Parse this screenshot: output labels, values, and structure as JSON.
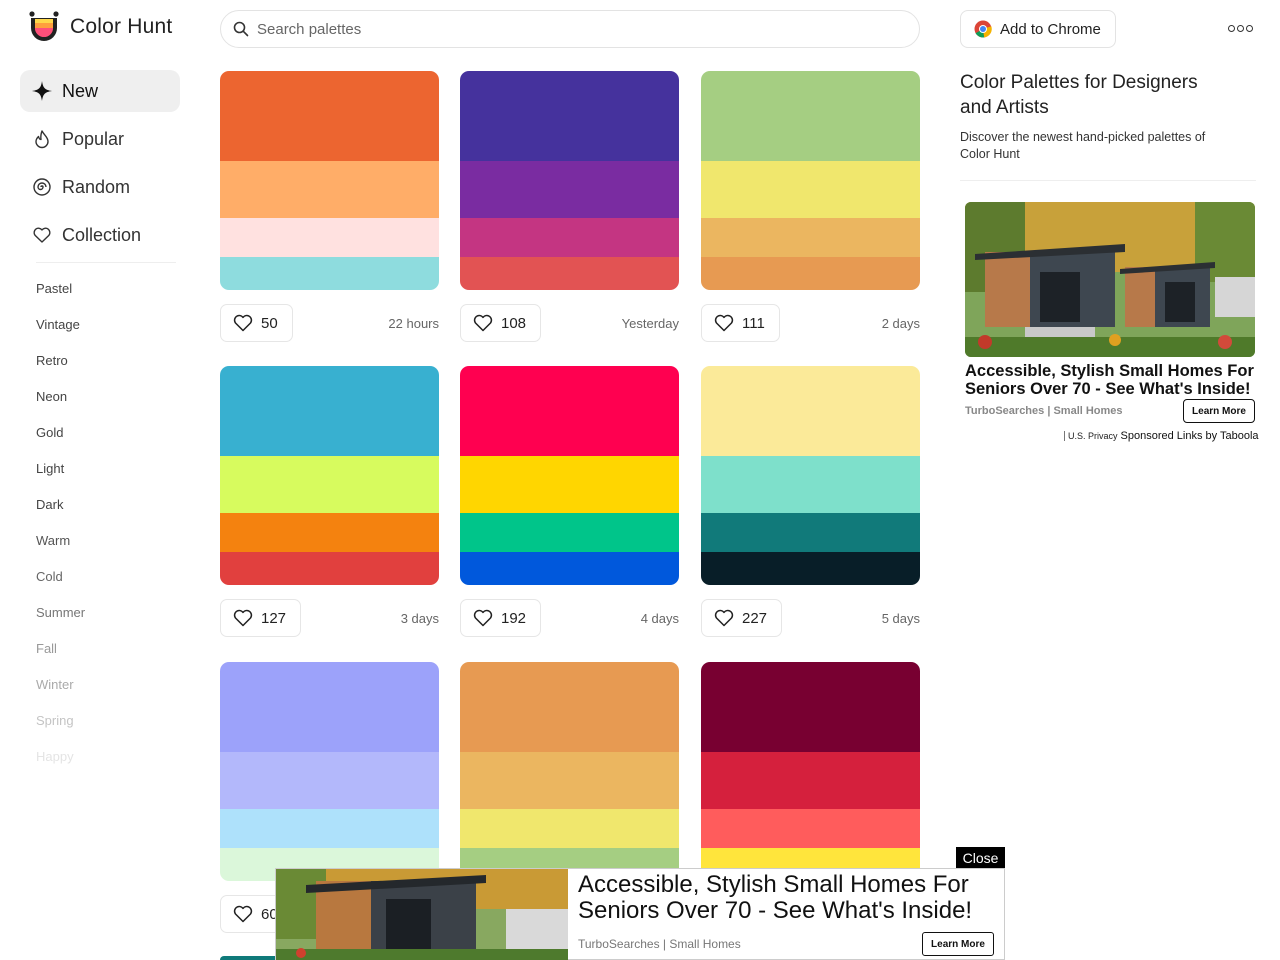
{
  "header": {
    "logo_title": "Color Hunt",
    "search_placeholder": "Search palettes",
    "chrome_button_label": "Add to Chrome"
  },
  "nav": {
    "items": [
      {
        "label": "New",
        "icon": "sparkle-icon",
        "active": true
      },
      {
        "label": "Popular",
        "icon": "flame-icon",
        "active": false
      },
      {
        "label": "Random",
        "icon": "spiral-icon",
        "active": false
      },
      {
        "label": "Collection",
        "icon": "heart-icon",
        "active": false
      }
    ],
    "tags": [
      "Pastel",
      "Vintage",
      "Retro",
      "Neon",
      "Gold",
      "Light",
      "Dark",
      "Warm",
      "Cold",
      "Summer",
      "Fall",
      "Winter",
      "Spring",
      "Happy"
    ]
  },
  "palettes": [
    {
      "colors": [
        "#EC6530",
        "#FFAD68",
        "#FFE1E0",
        "#8EDCDE"
      ],
      "likes": "50",
      "age": "22 hours"
    },
    {
      "colors": [
        "#45329D",
        "#7A2CA1",
        "#C43582",
        "#E25353"
      ],
      "likes": "108",
      "age": "Yesterday"
    },
    {
      "colors": [
        "#A5CE82",
        "#F0E76D",
        "#EBB660",
        "#E79A52"
      ],
      "likes": "111",
      "age": "2 days"
    },
    {
      "colors": [
        "#38B0D0",
        "#D7FB5E",
        "#F4820F",
        "#E1403E"
      ],
      "likes": "127",
      "age": "3 days"
    },
    {
      "colors": [
        "#FF0050",
        "#FFD600",
        "#00C58A",
        "#0058DC"
      ],
      "likes": "192",
      "age": "4 days"
    },
    {
      "colors": [
        "#FBEA99",
        "#7EE0CB",
        "#117A7A",
        "#081E28"
      ],
      "likes": "227",
      "age": "5 days"
    },
    {
      "colors": [
        "#9CA2FA",
        "#B3B8FB",
        "#AEE1FB",
        "#DBF7DA"
      ],
      "likes": "60",
      "age": ""
    },
    {
      "colors": [
        "#E79A52",
        "#EBB660",
        "#F0E76D",
        "#A5CE82"
      ],
      "likes": "",
      "age": ""
    },
    {
      "colors": [
        "#780031",
        "#D5203D",
        "#FF5C5C",
        "#FFE53C"
      ],
      "likes": "",
      "age": ""
    }
  ],
  "aside": {
    "title": "Color Palettes for Designers and Artists",
    "subtitle": "Discover the newest hand-picked palettes of Color Hunt"
  },
  "ad": {
    "headline": "Accessible, Stylish Small Homes For Seniors Over 70 - See What's Inside!",
    "source": "TurboSearches | Small Homes",
    "learn_more": "Learn More",
    "privacy": "U.S. Privacy",
    "sponsored": "Sponsored Links by Taboola"
  },
  "sticky_ad": {
    "headline": "Accessible, Stylish Small Homes For Seniors Over 70 - See What's Inside!",
    "source": "TurboSearches | Small Homes",
    "learn_more": "Learn More",
    "close": "Close"
  }
}
